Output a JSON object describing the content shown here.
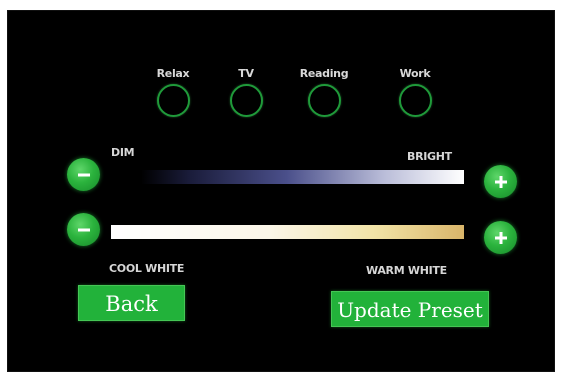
{
  "presets": [
    {
      "label": "Relax"
    },
    {
      "label": "TV"
    },
    {
      "label": "Reading"
    },
    {
      "label": "Work"
    }
  ],
  "brightness": {
    "min_label": "DIM",
    "max_label": "BRIGHT",
    "decrease_icon": "minus-icon",
    "increase_icon": "plus-icon"
  },
  "color_temp": {
    "min_label": "COOL WHITE",
    "max_label": "WARM WHITE",
    "decrease_icon": "minus-icon",
    "increase_icon": "plus-icon"
  },
  "buttons": {
    "back_label": "Back",
    "update_label": "Update Preset"
  },
  "colors": {
    "background": "#000000",
    "accent_green": "#22b23a",
    "ring_green": "#1f9a3a",
    "label_text": "#d8d8d8"
  }
}
